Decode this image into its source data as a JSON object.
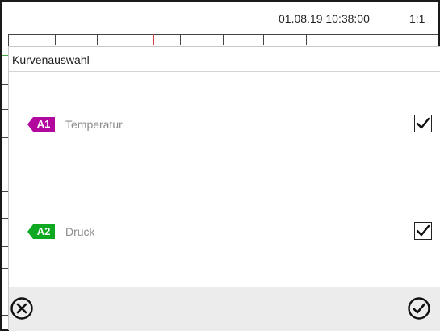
{
  "status_bar": {
    "datetime": "01.08.19 10:38:00",
    "view_mode": "1:1"
  },
  "dialog": {
    "title": "Kurvenauswahl",
    "curves": [
      {
        "badge": "A1",
        "label": "Temperatur",
        "checked": true,
        "color": "#b3089e"
      },
      {
        "badge": "A2",
        "label": "Druck",
        "checked": true,
        "color": "#0ea821"
      }
    ],
    "footer": {
      "cancel_icon": "cancel-circle-x-icon",
      "confirm_icon": "confirm-circle-check-icon"
    }
  },
  "colors": {
    "footer_bg": "#ececec",
    "frame": "#1a1a1a",
    "label_gray": "#8c8c8c"
  }
}
